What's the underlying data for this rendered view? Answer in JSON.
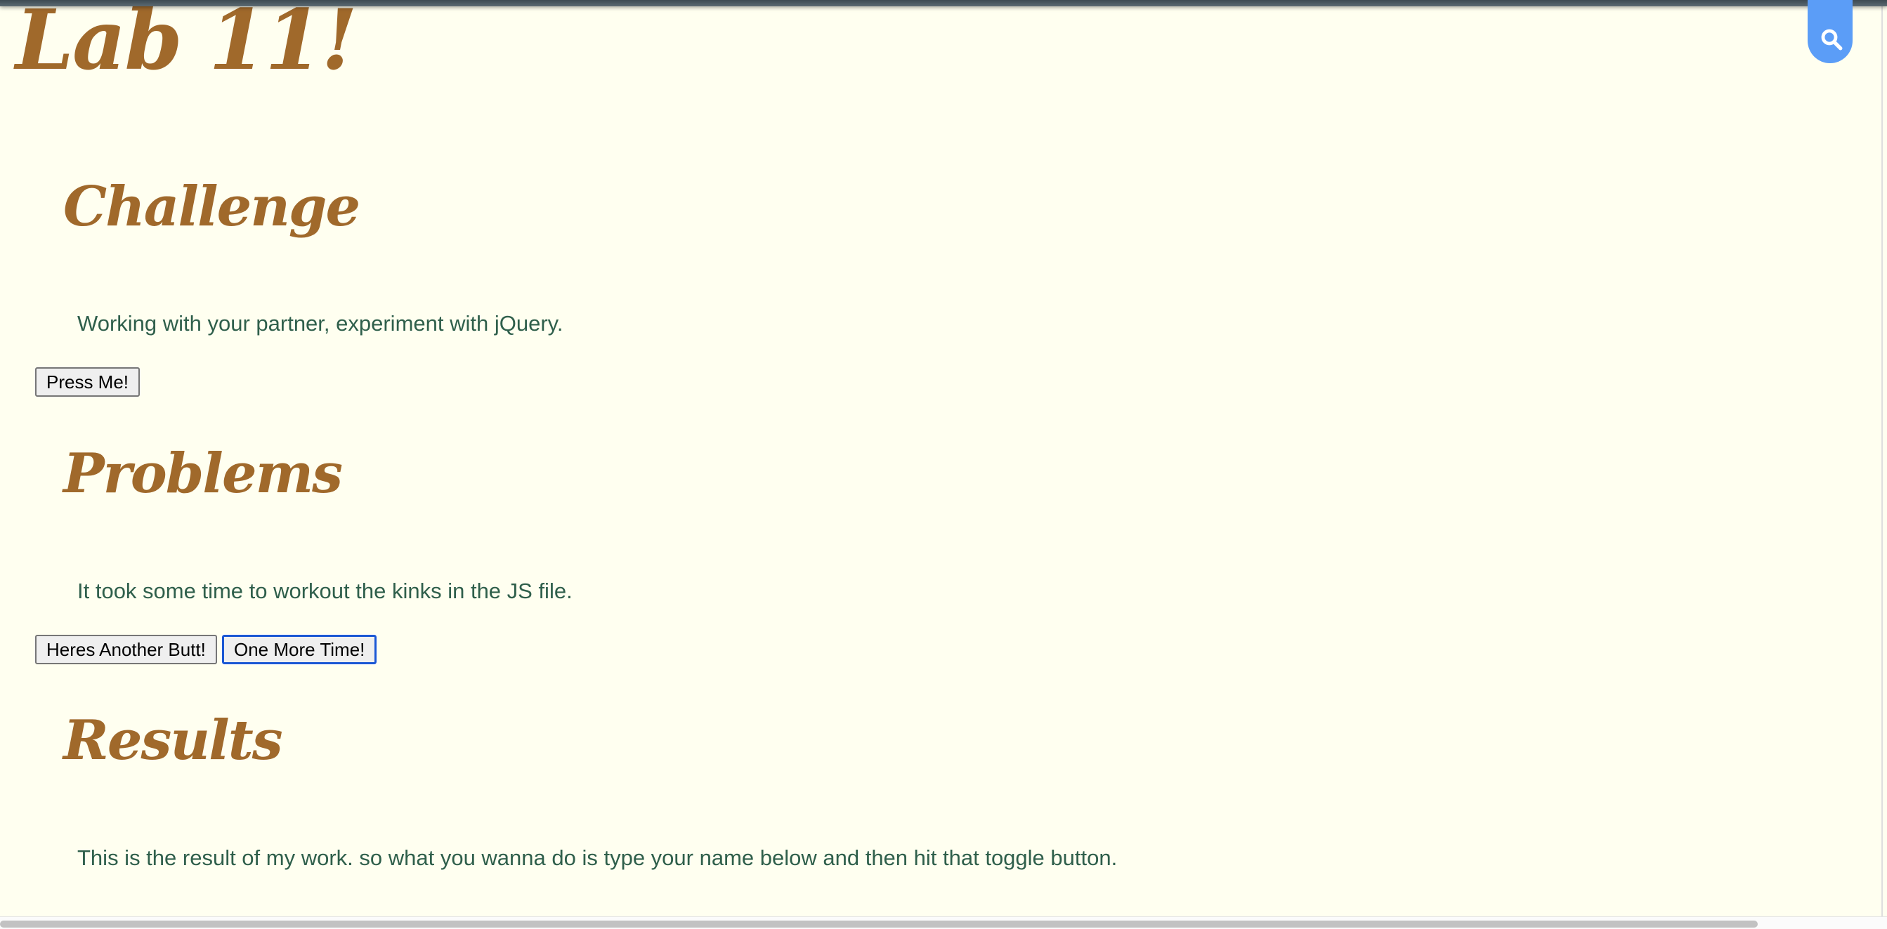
{
  "header": {
    "title": "Lab 11!",
    "search_icon": "search-icon"
  },
  "sections": {
    "challenge": {
      "heading": "Challenge",
      "text": "Working with your partner, experiment with jQuery.",
      "button": "Press Me!"
    },
    "problems": {
      "heading": "Problems",
      "text": "It took some time to workout the kinks in the JS file.",
      "buttons": [
        "Heres Another Butt!",
        "One More Time!"
      ]
    },
    "results": {
      "heading": "Results",
      "text": "This is the result of my work. so what you wanna do is type your name below and then hit that toggle button."
    }
  },
  "colors": {
    "background": "#fffff0",
    "heading": "#a0692b",
    "body_text": "#2f5f4b",
    "search_tab": "#5b9df7",
    "focus_ring": "#1a57d4"
  }
}
